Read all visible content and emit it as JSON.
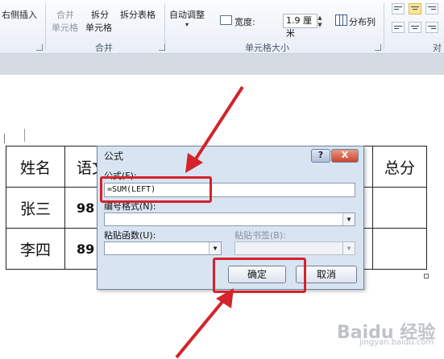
{
  "ribbon": {
    "insert_right": "右侧插入",
    "merge_cells_1": "合并",
    "merge_cells_2": "单元格",
    "split_cells_1": "拆分",
    "split_cells_2": "单元格",
    "split_table": "拆分表格",
    "auto_fit": "自动调整",
    "width_label": "宽度:",
    "width_value": "1.9 厘米",
    "distribute_cols": "分布列",
    "group_merge": "合并",
    "group_cell_size": "单元格大小",
    "group_align_partial": "对"
  },
  "table": {
    "rows": [
      [
        "姓名",
        "语文",
        "总分"
      ],
      [
        "张三",
        "98",
        ""
      ],
      [
        "李四",
        "89",
        ""
      ]
    ]
  },
  "dialog": {
    "title": "公式",
    "help": "?",
    "close": "X",
    "formula_label": "公式(F):",
    "formula_value": "=SUM(LEFT)",
    "number_format_label": "编号格式(N):",
    "paste_function_label": "粘贴函数(U):",
    "paste_bookmark_label": "粘贴书签(B):",
    "ok": "确定",
    "cancel": "取消"
  },
  "watermark": {
    "brand": "Baidu 经验",
    "sub": "jingyan.baidu.com"
  },
  "colors": {
    "annotation_red": "#d4232a",
    "dialog_bg": "#d9e4f2"
  }
}
